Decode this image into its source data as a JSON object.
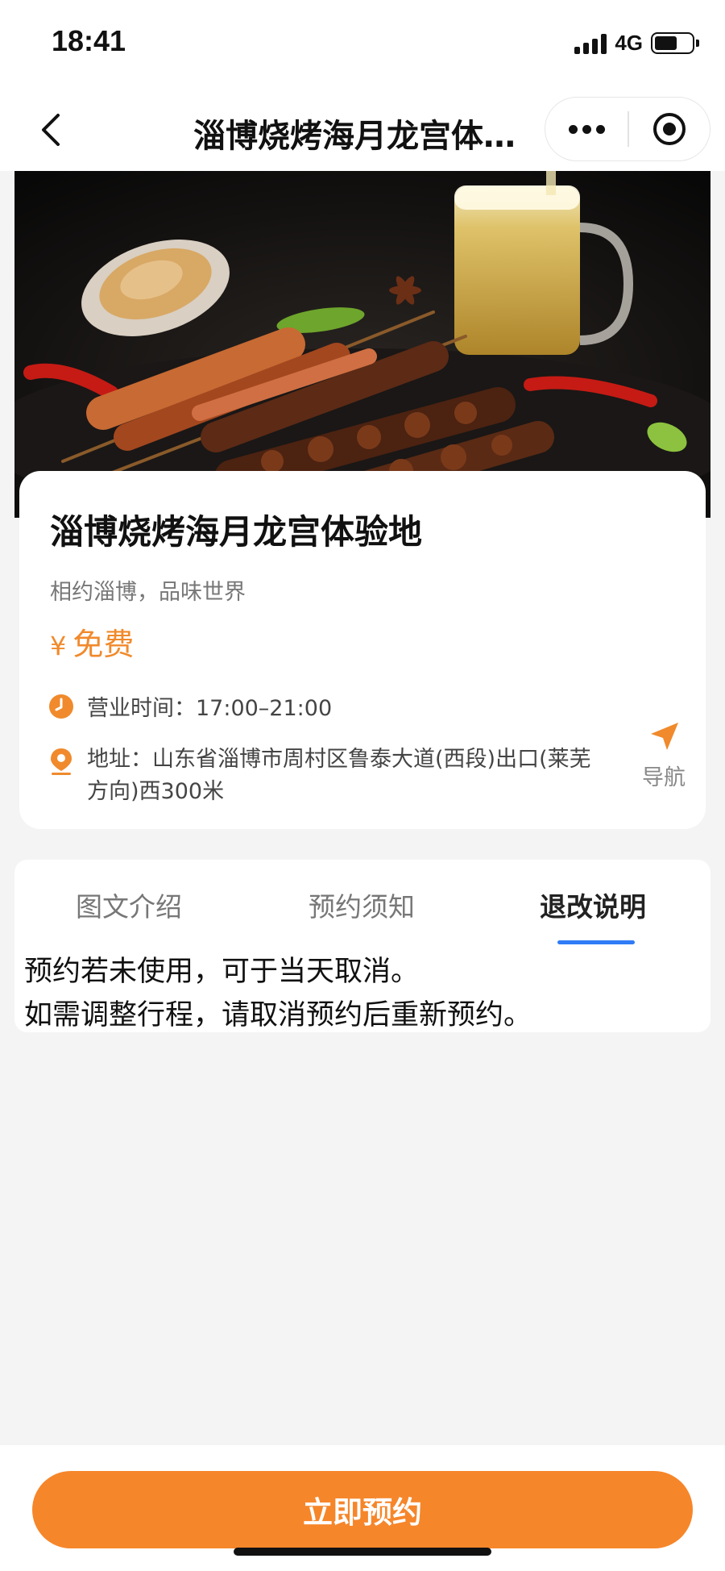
{
  "status_bar": {
    "time": "18:41",
    "network": "4G",
    "signal_bars": 4,
    "battery_level": 0.62
  },
  "nav": {
    "title": "淄博烧烤海月龙宫体验地",
    "back_icon": "chevron-left-icon",
    "more_icon": "more-dots-icon",
    "close_icon": "target-icon"
  },
  "hero": {
    "image": "bbq-skewers-and-beer-photo"
  },
  "venue": {
    "title": "淄博烧烤海月龙宫体验地",
    "subtitle": "相约淄博，品味世界",
    "price_symbol": "¥",
    "price": "免费",
    "hours_label": "营业时间：17:00–21:00",
    "address_label": "地址：山东省淄博市周村区鲁泰大道(西段)出口(莱芜方向)西300米",
    "navigate_label": "导航",
    "accent_color": "#f08a2c"
  },
  "tabs": {
    "items": [
      {
        "label": "图文介绍"
      },
      {
        "label": "预约须知"
      },
      {
        "label": "退改说明"
      }
    ],
    "active_index": 2,
    "underline_color": "#2f7cf6"
  },
  "policy": {
    "lines": [
      "预约若未使用，可于当天取消。",
      "如需调整行程，请取消预约后重新预约。"
    ]
  },
  "footer": {
    "book_label": "立即预约",
    "button_color": "#f6862a"
  }
}
